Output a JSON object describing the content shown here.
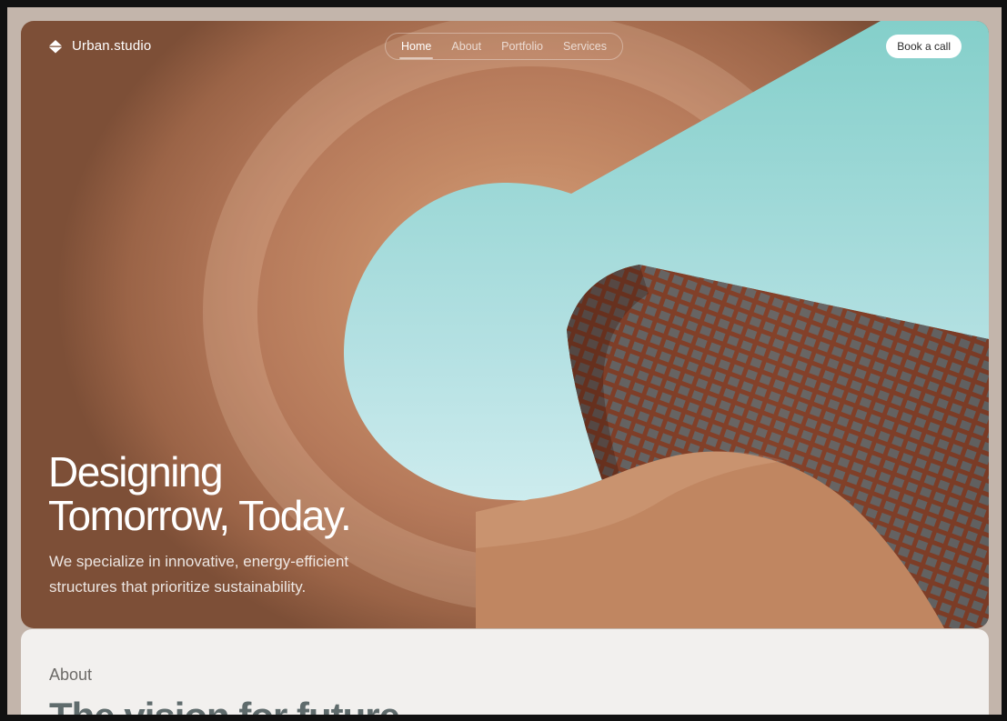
{
  "brand": {
    "name": "Urban.studio",
    "icon": "stacked-chevron-up-icon"
  },
  "nav": {
    "items": [
      {
        "label": "Home",
        "active": true
      },
      {
        "label": "About",
        "active": false
      },
      {
        "label": "Portfolio",
        "active": false
      },
      {
        "label": "Services",
        "active": false
      }
    ],
    "cta_label": "Book a call"
  },
  "hero": {
    "headline_line1": "Designing",
    "headline_line2": "Tomorrow, Today.",
    "subtext": "We specialize in innovative, energy-efficient structures that prioritize sustainability."
  },
  "about": {
    "label": "About",
    "title": "The vision for future"
  },
  "colors": {
    "terracotta": "#b5795a",
    "sky": "#a6dcdc",
    "frame": "#c3b5ab",
    "section_bg": "#f2f0ee"
  }
}
